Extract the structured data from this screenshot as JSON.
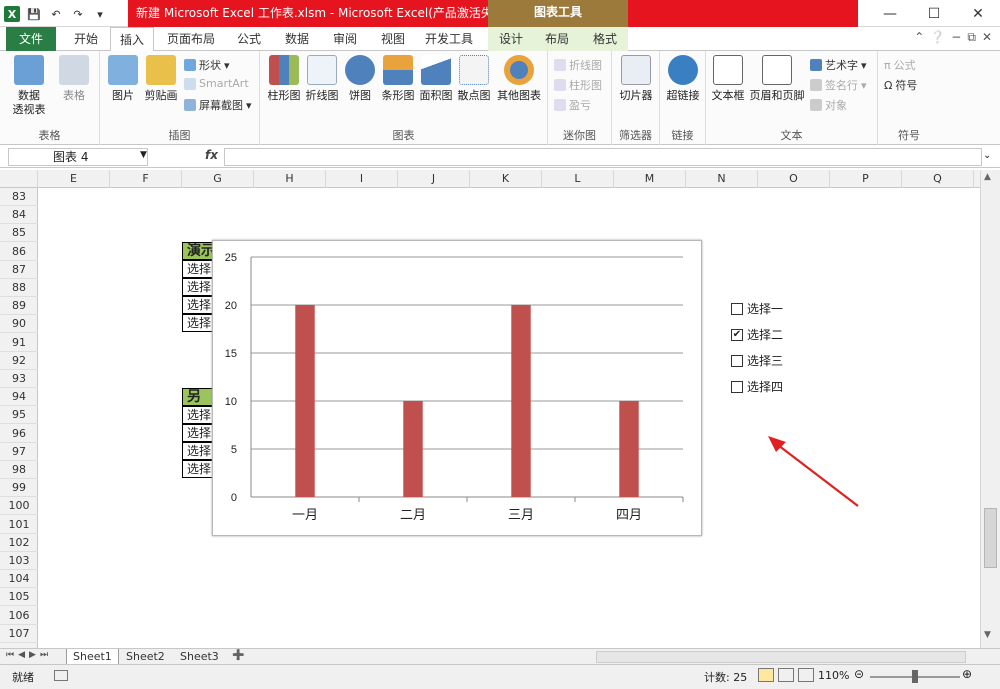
{
  "titlebar": {
    "logo": "X",
    "file_title": "新建 Microsoft Excel 工作表.xlsm - Microsoft Excel(产品激活失败)",
    "chart_tools": "图表工具"
  },
  "tabs": {
    "file": "文件",
    "home": "开始",
    "insert": "插入",
    "page_layout": "页面布局",
    "formulas": "公式",
    "data": "数据",
    "review": "审阅",
    "view": "视图",
    "developer": "开发工具",
    "design": "设计",
    "layout": "布局",
    "format": "格式"
  },
  "ribbon": {
    "tables": {
      "label": "表格",
      "pivot": "数据\n透视表",
      "table": "表格"
    },
    "illustrations": {
      "label": "插图",
      "picture": "图片",
      "clipart": "剪贴画",
      "shapes": "形状",
      "smartart": "SmartArt",
      "screenshot": "屏幕截图"
    },
    "charts": {
      "label": "图表",
      "column": "柱形图",
      "line": "折线图",
      "pie": "饼图",
      "bar": "条形图",
      "area": "面积图",
      "scatter": "散点图",
      "other": "其他图表"
    },
    "sparklines": {
      "label": "迷你图",
      "line": "折线图",
      "column": "柱形图",
      "winloss": "盈亏"
    },
    "filter": {
      "label": "筛选器",
      "slicer": "切片器"
    },
    "links": {
      "label": "链接",
      "hyperlink": "超链接"
    },
    "text": {
      "label": "文本",
      "textbox": "文本框",
      "header_footer": "页眉和页脚",
      "wordart": "艺术字",
      "signature": "签名行",
      "object": "对象"
    },
    "symbols": {
      "label": "符号",
      "equation": "公式",
      "symbol": "符号"
    }
  },
  "formula_bar": {
    "name_box": "图表 4",
    "fx": "fx"
  },
  "columns": [
    "E",
    "F",
    "G",
    "H",
    "I",
    "J",
    "K",
    "L",
    "M",
    "N",
    "O",
    "P",
    "Q"
  ],
  "rows": [
    "83",
    "84",
    "85",
    "86",
    "87",
    "88",
    "89",
    "90",
    "91",
    "92",
    "93",
    "94",
    "95",
    "96",
    "97",
    "98",
    "99",
    "100",
    "101",
    "102",
    "103",
    "104",
    "105",
    "106",
    "107"
  ],
  "table1": {
    "header": "演示",
    "cells": [
      "选择",
      "选择",
      "选择",
      "选择"
    ]
  },
  "table2": {
    "header": "另",
    "cells": [
      "选择",
      "选择",
      "选择",
      "选择"
    ]
  },
  "chart_data": {
    "type": "bar",
    "categories": [
      "一月",
      "二月",
      "三月",
      "四月"
    ],
    "values": [
      20,
      10,
      20,
      10
    ],
    "ylim": [
      0,
      25
    ],
    "yticks": [
      "0",
      "5",
      "10",
      "15",
      "20",
      "25"
    ],
    "bar_color": "#c0504d",
    "grid": true
  },
  "checkboxes": [
    {
      "label": "选择一",
      "checked": false
    },
    {
      "label": "选择二",
      "checked": true
    },
    {
      "label": "选择三",
      "checked": false
    },
    {
      "label": "选择四",
      "checked": false
    }
  ],
  "sheets": [
    "Sheet1",
    "Sheet2",
    "Sheet3"
  ],
  "status": {
    "ready": "就绪",
    "count": "计数: 25",
    "zoom": "110%"
  }
}
